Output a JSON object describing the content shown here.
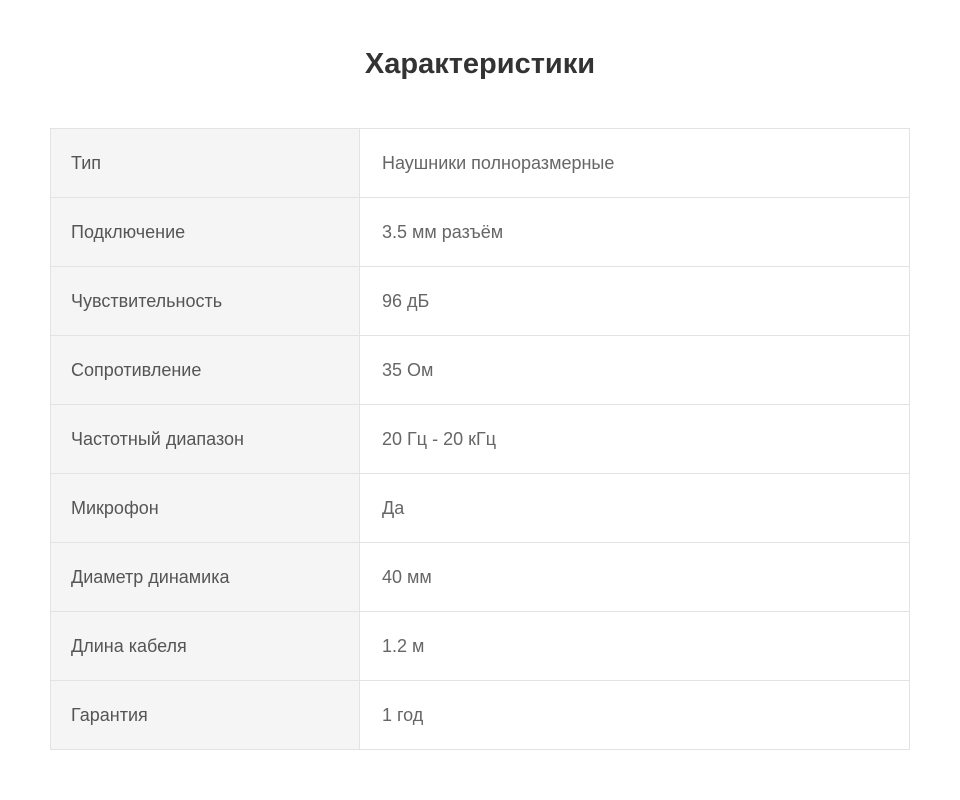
{
  "title": "Характеристики",
  "specs": [
    {
      "key": "Тип",
      "value": "Наушники полноразмерные"
    },
    {
      "key": "Подключение",
      "value": "3.5 мм разъём"
    },
    {
      "key": "Чувствительность",
      "value": "96 дБ"
    },
    {
      "key": "Сопротивление",
      "value": "35 Ом"
    },
    {
      "key": "Частотный диапазон",
      "value": "20 Гц - 20 кГц"
    },
    {
      "key": "Микрофон",
      "value": "Да"
    },
    {
      "key": "Диаметр динамика",
      "value": "40 мм"
    },
    {
      "key": "Длина кабеля",
      "value": "1.2 м"
    },
    {
      "key": "Гарантия",
      "value": "1 год"
    }
  ]
}
